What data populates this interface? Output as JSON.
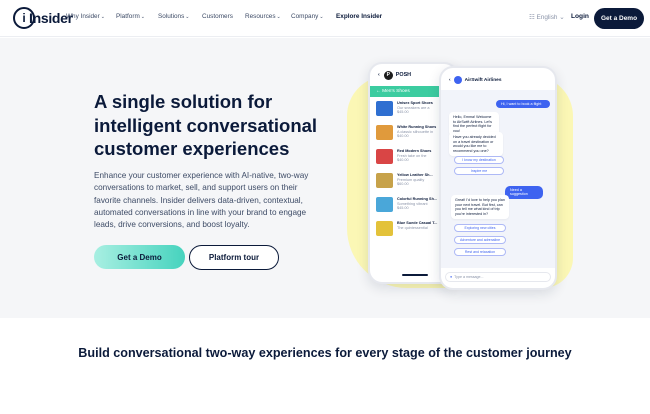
{
  "nav": {
    "logo": "Insider",
    "items": [
      {
        "label": "Why Insider",
        "has_menu": true
      },
      {
        "label": "Platform",
        "has_menu": true
      },
      {
        "label": "Solutions",
        "has_menu": true
      },
      {
        "label": "Customers",
        "has_menu": false
      },
      {
        "label": "Resources",
        "has_menu": true
      },
      {
        "label": "Company",
        "has_menu": true
      },
      {
        "label": "Explore Insider",
        "has_menu": false
      }
    ],
    "language": "English",
    "login": "Login",
    "cta": "Get a Demo"
  },
  "hero": {
    "title": "A single solution for intelligent conversational customer experiences",
    "description": "Enhance your customer experience with AI-native, two-way conversations to market, sell, and support users on their favorite channels. Insider delivers data-driven, contextual, automated conversations in line with your brand to engage leads, drive conversions, and boost loyalty.",
    "primary_button": "Get a Demo",
    "secondary_button": "Platform tour"
  },
  "phone_shop": {
    "brand": "POSH",
    "category": "Men's Shoes",
    "products": [
      {
        "name": "Unisex Sport Shoes",
        "desc": "Our sneakers are a",
        "price": "$45.00",
        "color": "#2f6fd1"
      },
      {
        "name": "White Running Shoes",
        "desc": "A classic silhouette in",
        "price": "$40.00",
        "color": "#e09a3c"
      },
      {
        "name": "Red Modern Shoes",
        "desc": "Fresh take on the",
        "price": "$40.00",
        "color": "#d94545"
      },
      {
        "name": "Yellow Leather Sh...",
        "desc": "Premium quality",
        "price": "$60.00",
        "color": "#c7a24a"
      },
      {
        "name": "Colorful Running Sh...",
        "desc": "Something vibrant",
        "price": "$45.00",
        "color": "#4aa7d9"
      },
      {
        "name": "Blue Suede Casual T...",
        "desc": "The quintessential",
        "price": "",
        "color": "#e3c23a"
      }
    ]
  },
  "phone_chat": {
    "airline": "AirSwift Airlines",
    "messages": [
      {
        "from": "user",
        "text": "Hi, I want to book a flight"
      },
      {
        "from": "bot",
        "text": "Hello, Emma! Welcome to AirSwift Airlines. Let's find the perfect flight for you!"
      },
      {
        "from": "bot",
        "text": "Have you already decided on a travel destination or would you like me to recommend you one?"
      },
      {
        "from": "user",
        "text": "Need a suggestion"
      },
      {
        "from": "bot",
        "text": "Great! I'd love to help you plan your next travel. But first, can you tell me what kind of trip you're interested in?"
      }
    ],
    "chips_top": [
      "I know my destination",
      "Inspire me"
    ],
    "chips_bottom": [
      "Exploring new cities",
      "Adventure and adrenaline",
      "Rest and relaxation"
    ],
    "input_placeholder": "Type a message..."
  },
  "section2": {
    "heading": "Build conversational two-way experiences for every stage of the customer journey"
  },
  "colors": {
    "navy": "#0b1a3a",
    "teal_gradient_end": "#46d3be",
    "chat_blue": "#3e63f0",
    "hero_bg": "#f5f6f8",
    "blob_yellow": "#fbf7b5"
  }
}
